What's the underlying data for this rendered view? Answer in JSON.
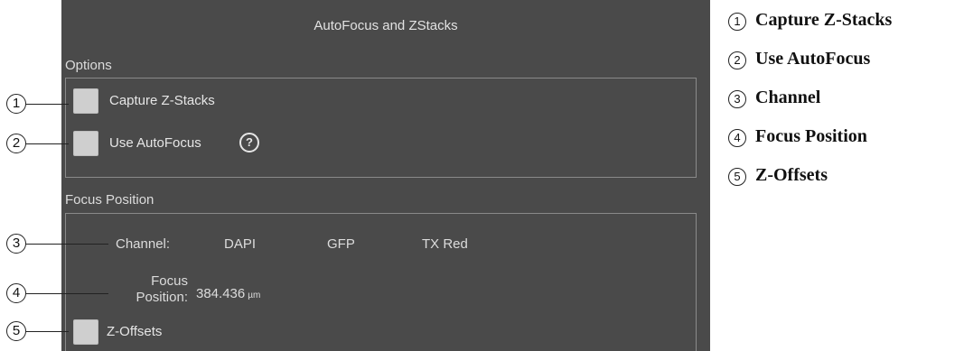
{
  "panel": {
    "title": "AutoFocus and ZStacks",
    "options": {
      "label": "Options",
      "capture_zstacks": {
        "label": "Capture Z-Stacks",
        "checked": false
      },
      "use_autofocus": {
        "label": "Use AutoFocus",
        "checked": false
      },
      "help_icon": "?"
    },
    "focus": {
      "label": "Focus Position",
      "channel_label": "Channel:",
      "channels": [
        "DAPI",
        "GFP",
        "TX Red"
      ],
      "position_label_line1": "Focus",
      "position_label_line2": "Position:",
      "position_value": "384.436",
      "position_unit": "µm",
      "zoffsets": {
        "label": "Z-Offsets",
        "checked": false
      }
    }
  },
  "callouts": [
    "1",
    "2",
    "3",
    "4",
    "5"
  ],
  "legend": [
    {
      "num": "1",
      "text": "Capture Z-Stacks"
    },
    {
      "num": "2",
      "text": "Use AutoFocus"
    },
    {
      "num": "3",
      "text": "Channel"
    },
    {
      "num": "4",
      "text": "Focus Position"
    },
    {
      "num": "5",
      "text": "Z-Offsets"
    }
  ]
}
